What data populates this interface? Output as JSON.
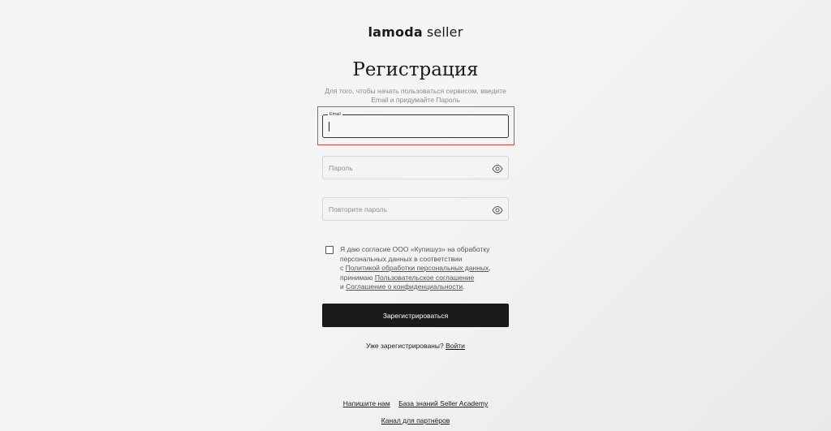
{
  "logo": {
    "brand": "lamoda",
    "suffix": "seller"
  },
  "title": "Регистрация",
  "subtitle": "Для того, чтобы начать пользоваться сервисом, введите Email и придумайте Пароль",
  "form": {
    "email_label": "Email",
    "email_value": "",
    "password_placeholder": "Пароль",
    "repeat_password_placeholder": "Повторите пароль",
    "eye_icon": "eye-icon"
  },
  "consent": {
    "text_part1": "Я даю согласие ООО «Купишуз» на обработку персональных данных в соответствии",
    "text_part2": "с ",
    "link_policy": "Политикой обработки персональных данных",
    "text_part3": ",",
    "text_part4": "принимаю ",
    "link_agreement": "Пользовательское соглашение",
    "text_part5": "и ",
    "link_privacy": "Соглашение о конфиденциальности",
    "text_part6": "."
  },
  "submit_label": "Зарегистрироваться",
  "login": {
    "question": "Уже зарегистрированы?",
    "link": "Войти"
  },
  "footer": {
    "write_us": "Напишите нам",
    "knowledge_base": "База знаний Seller Academy",
    "partner_channel": "Канал для партнёров"
  },
  "colors": {
    "button_bg": "#1a1a1a",
    "highlight": "#e8473f"
  }
}
